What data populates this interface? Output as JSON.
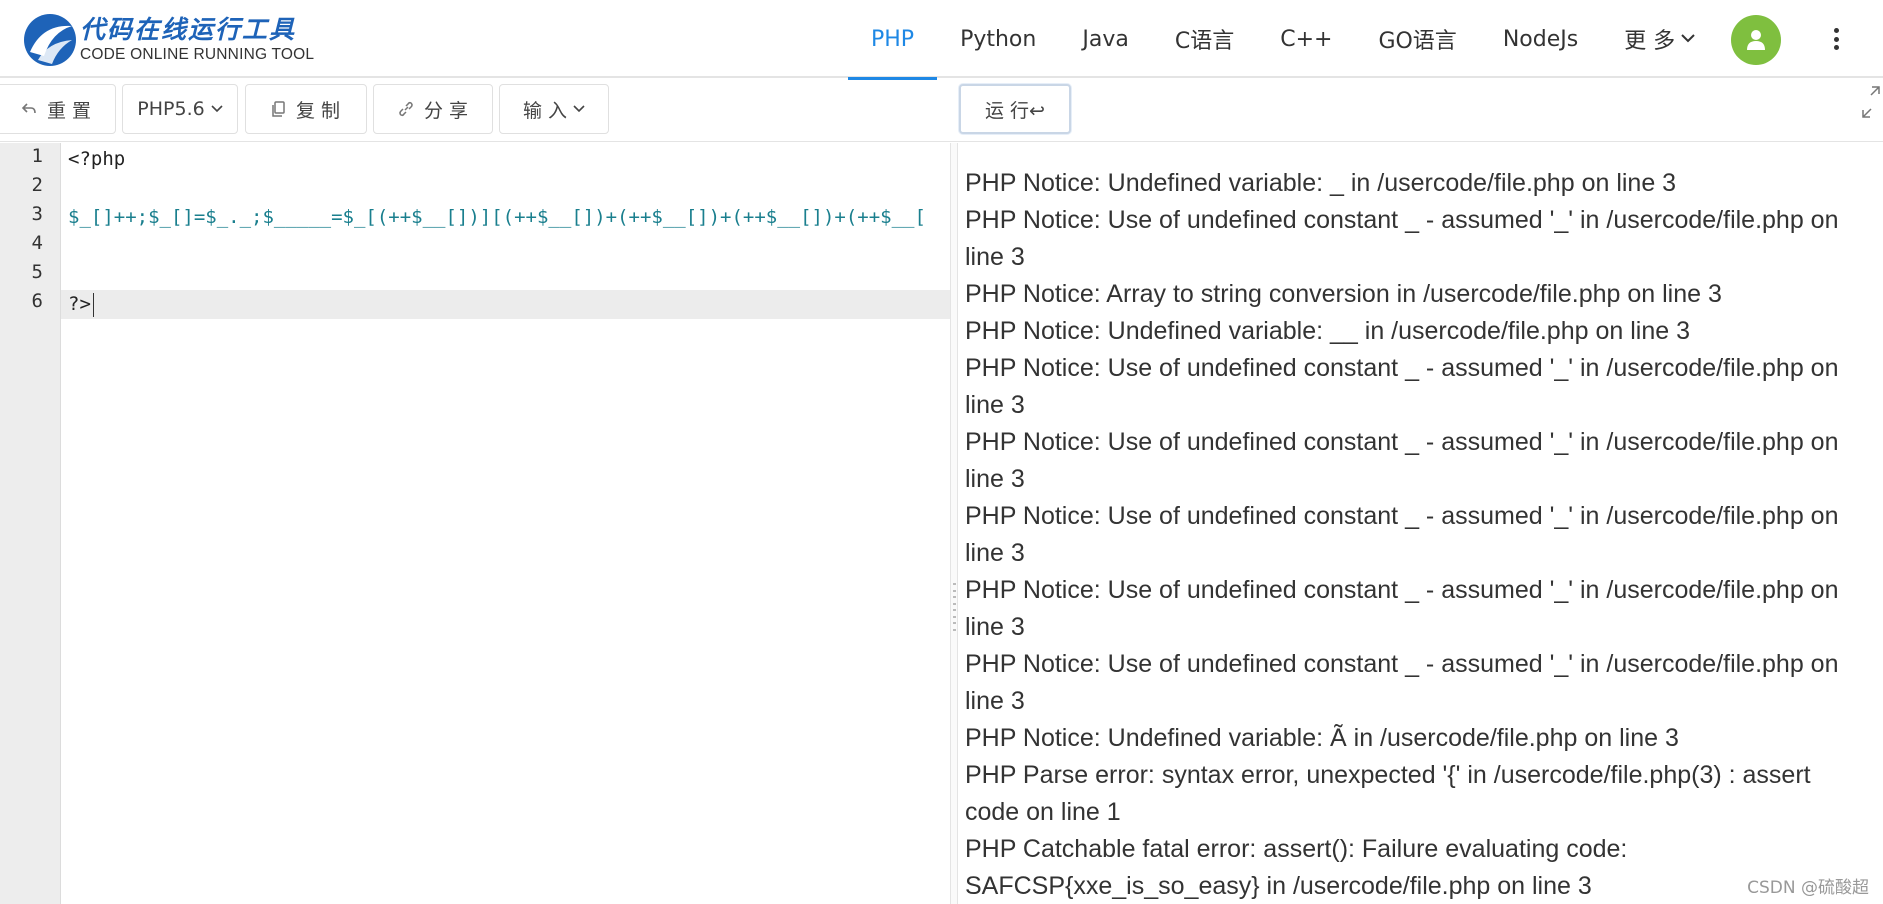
{
  "brand": {
    "name_cn": "代码在线运行工具",
    "name_en": "CODE ONLINE RUNNING TOOL",
    "brand_color": "#1e63b8"
  },
  "nav": {
    "items": [
      {
        "label": "PHP",
        "active": true
      },
      {
        "label": "Python"
      },
      {
        "label": "Java"
      },
      {
        "label": "C语言"
      },
      {
        "label": "C++"
      },
      {
        "label": "GO语言"
      },
      {
        "label": "NodeJs"
      }
    ],
    "more_label": "更 多",
    "accent_color": "#1e88e5",
    "avatar_color": "#7fbf3f"
  },
  "toolbar": {
    "reset_label": "重 置",
    "version_label": "PHP5.6",
    "copy_label": "复 制",
    "share_label": "分 享",
    "input_label": "输 入",
    "run_label": "运 行↩"
  },
  "editor": {
    "line_numbers": [
      "1",
      "2",
      "3",
      "4",
      "5",
      "6"
    ],
    "lines": [
      "<?php",
      "",
      "$_[]++;$_[]=$_._;$_____=$_[(++$__[])][(++$__[])+(++$__[])+(++$__[])+(++$__[",
      "",
      "",
      "?>"
    ],
    "active_line": 6
  },
  "output": {
    "lines": [
      "PHP Notice:  Undefined variable: _ in /usercode/file.php on line 3",
      "PHP Notice:  Use of undefined constant _ - assumed '_' in /usercode/file.php on line 3",
      "PHP Notice:  Array to string conversion in /usercode/file.php on line 3",
      "PHP Notice:  Undefined variable: __ in /usercode/file.php on line 3",
      "PHP Notice:  Use of undefined constant _ - assumed '_' in /usercode/file.php on line 3",
      "PHP Notice:  Use of undefined constant _ - assumed '_' in /usercode/file.php on line 3",
      "PHP Notice:  Use of undefined constant _ - assumed '_' in /usercode/file.php on line 3",
      "PHP Notice:  Use of undefined constant _ - assumed '_' in /usercode/file.php on line 3",
      "PHP Notice:  Use of undefined constant _ - assumed '_' in /usercode/file.php on line 3",
      "PHP Notice:  Undefined variable: Ã in /usercode/file.php on line 3",
      "PHP Parse error:  syntax error, unexpected '{' in /usercode/file.php(3) : assert code on line 1",
      "PHP Catchable fatal error:  assert(): Failure evaluating code: SAFCSP{xxe_is_so_easy} in /usercode/file.php on line 3"
    ]
  },
  "watermark": "CSDN @硫酸超"
}
